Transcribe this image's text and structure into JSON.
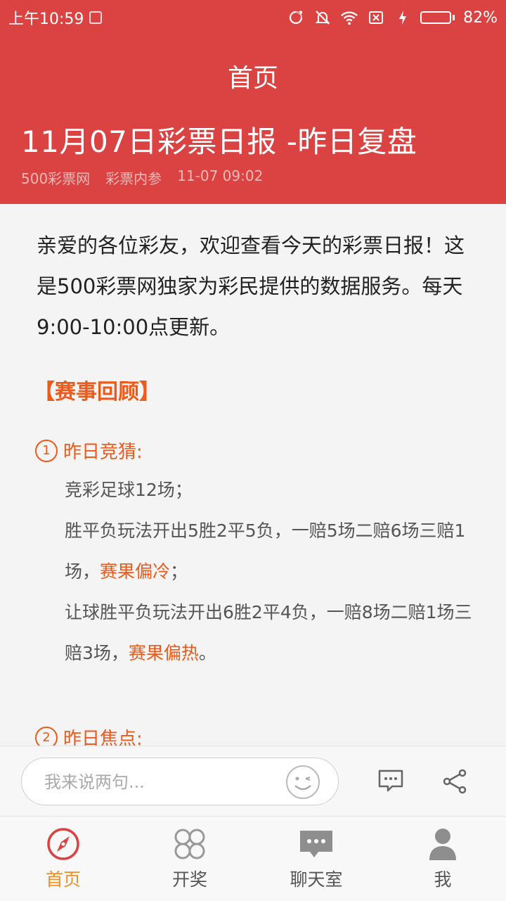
{
  "status_bar": {
    "time": "上午10:59",
    "battery": "82%",
    "battery_level": 0.82,
    "battery_color": "#5bd36a"
  },
  "header": {
    "nav_title": "首页",
    "article_title": "11月07日彩票日报 -昨日复盘",
    "source": "500彩票网",
    "category": "彩票内参",
    "datetime": "11-07 09:02",
    "background": "#db4343"
  },
  "article": {
    "intro": "亲爱的各位彩友，欢迎查看今天的彩票日报！这是500彩票网独家为彩民提供的数据服务。每天9:00-10:00点更新。",
    "section_title": "【赛事回顾】",
    "sub1": {
      "num": "1",
      "title": "昨日竞猜:",
      "line1": "竞彩足球12场；",
      "line2_a": "胜平负玩法开出5胜2平5负，一赔5场二赔6场三赔1场，",
      "line2_hl": "赛果偏冷",
      "line2_b": "；",
      "line3_a": "让球胜平负玩法开出6胜2平4负，一赔8场二赔1场三赔3场，",
      "line3_hl": "赛果偏热",
      "line3_b": "。"
    },
    "sub2": {
      "num": "2",
      "title": "昨日焦点:"
    },
    "highlight_color": "#ee5a1a"
  },
  "comment_bar": {
    "placeholder": "我来说两句..."
  },
  "tabs": [
    {
      "label": "首页",
      "icon": "compass-icon",
      "active": true
    },
    {
      "label": "开奖",
      "icon": "grid-icon",
      "active": false
    },
    {
      "label": "聊天室",
      "icon": "chat-icon",
      "active": false
    },
    {
      "label": "我",
      "icon": "user-icon",
      "active": false
    }
  ],
  "active_tab_color": "#ee8f2a"
}
